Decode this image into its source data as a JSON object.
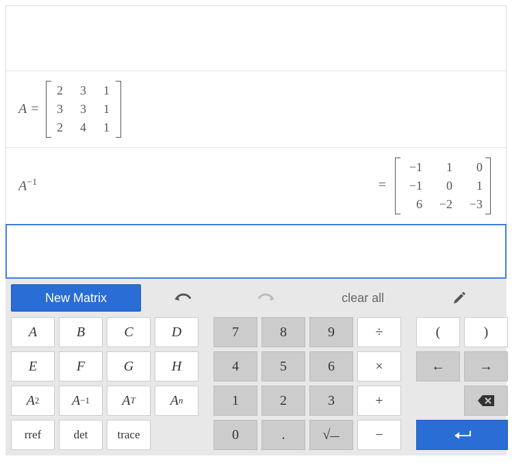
{
  "rows": {
    "definition": {
      "name": "A",
      "equals": "=",
      "matrix": [
        [
          "2",
          "3",
          "1"
        ],
        [
          "3",
          "3",
          "1"
        ],
        [
          "2",
          "4",
          "1"
        ]
      ]
    },
    "result": {
      "expr_base": "A",
      "expr_exp": "−1",
      "equals": "=",
      "matrix": [
        [
          "−1",
          "1",
          "0"
        ],
        [
          "−1",
          "0",
          "1"
        ],
        [
          "6",
          "−2",
          "−3"
        ]
      ]
    }
  },
  "toolbar": {
    "new_matrix": "New Matrix",
    "clear_all": "clear all"
  },
  "keys": {
    "vars": {
      "A": "A",
      "B": "B",
      "C": "C",
      "D": "D",
      "E": "E",
      "F": "F",
      "G": "G",
      "H": "H"
    },
    "ops": {
      "A2_base": "A",
      "A2_exp": "2",
      "Ainv_base": "A",
      "Ainv_exp": "−1",
      "AT_base": "A",
      "AT_exp": "T",
      "An_base": "A",
      "An_exp": "n",
      "rref": "rref",
      "det": "det",
      "trace": "trace"
    },
    "nums": {
      "7": "7",
      "8": "8",
      "9": "9",
      "div": "÷",
      "4": "4",
      "5": "5",
      "6": "6",
      "mul": "×",
      "1": "1",
      "2": "2",
      "3": "3",
      "add": "+",
      "0": "0",
      "dot": ".",
      "sqrt": "√",
      "sub": "−"
    },
    "misc": {
      "lparen": "(",
      "rparen": ")",
      "left": "←",
      "right": "→"
    }
  }
}
